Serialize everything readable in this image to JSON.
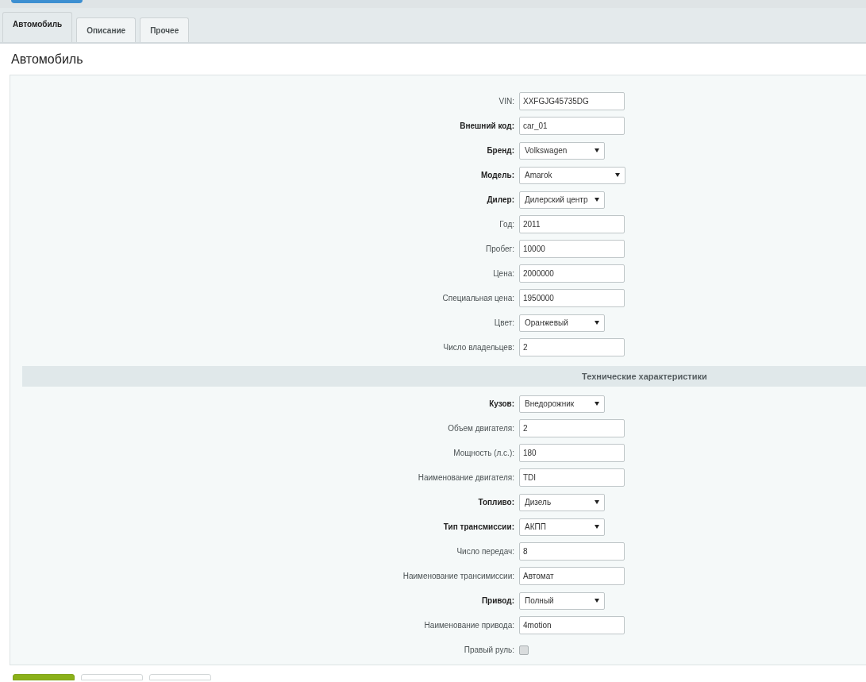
{
  "tabs": [
    {
      "label": "Автомобиль",
      "selected": true
    },
    {
      "label": "Описание",
      "selected": false
    },
    {
      "label": "Прочее",
      "selected": false
    }
  ],
  "heading": "Автомобиль",
  "fields": [
    {
      "kind": "text",
      "label": "VIN:",
      "required": false,
      "value": "XXFGJG45735DG"
    },
    {
      "kind": "text",
      "label": "Внешний код:",
      "required": true,
      "value": "car_01"
    },
    {
      "kind": "select",
      "label": "Бренд:",
      "required": true,
      "value": "Volkswagen"
    },
    {
      "kind": "select",
      "label": "Модель:",
      "required": true,
      "value": "Amarok",
      "wide": true
    },
    {
      "kind": "select",
      "label": "Дилер:",
      "required": true,
      "value": "Дилерский центр"
    },
    {
      "kind": "text",
      "label": "Год:",
      "required": false,
      "value": "2011"
    },
    {
      "kind": "text",
      "label": "Пробег:",
      "required": false,
      "value": "10000"
    },
    {
      "kind": "text",
      "label": "Цена:",
      "required": false,
      "value": "2000000"
    },
    {
      "kind": "text",
      "label": "Специальная цена:",
      "required": false,
      "value": "1950000"
    },
    {
      "kind": "select",
      "label": "Цвет:",
      "required": false,
      "value": "Оранжевый"
    },
    {
      "kind": "text",
      "label": "Число владельцев:",
      "required": false,
      "value": "2"
    },
    {
      "kind": "section",
      "label": "Технические характеристики"
    },
    {
      "kind": "select",
      "label": "Кузов:",
      "required": true,
      "value": "Внедорожник"
    },
    {
      "kind": "text",
      "label": "Объем двигателя:",
      "required": false,
      "value": "2"
    },
    {
      "kind": "text",
      "label": "Мощность (л.с.):",
      "required": false,
      "value": "180"
    },
    {
      "kind": "text",
      "label": "Наименование двигателя:",
      "required": false,
      "value": "TDI"
    },
    {
      "kind": "select",
      "label": "Топливо:",
      "required": true,
      "value": "Дизель"
    },
    {
      "kind": "select",
      "label": "Тип трансмиссии:",
      "required": true,
      "value": "АКПП"
    },
    {
      "kind": "text",
      "label": "Число передач:",
      "required": false,
      "value": "8"
    },
    {
      "kind": "text",
      "label": "Наименование трансимиссии:",
      "required": false,
      "value": "Автомат"
    },
    {
      "kind": "select",
      "label": "Привод:",
      "required": true,
      "value": "Полный"
    },
    {
      "kind": "text",
      "label": "Наименование привода:",
      "required": false,
      "value": "4motion"
    },
    {
      "kind": "checkbox",
      "label": "Правый руль:",
      "required": false,
      "checked": false
    }
  ],
  "buttons": [
    {
      "kind": "primary"
    },
    {
      "kind": "secondary"
    },
    {
      "kind": "secondary"
    }
  ]
}
